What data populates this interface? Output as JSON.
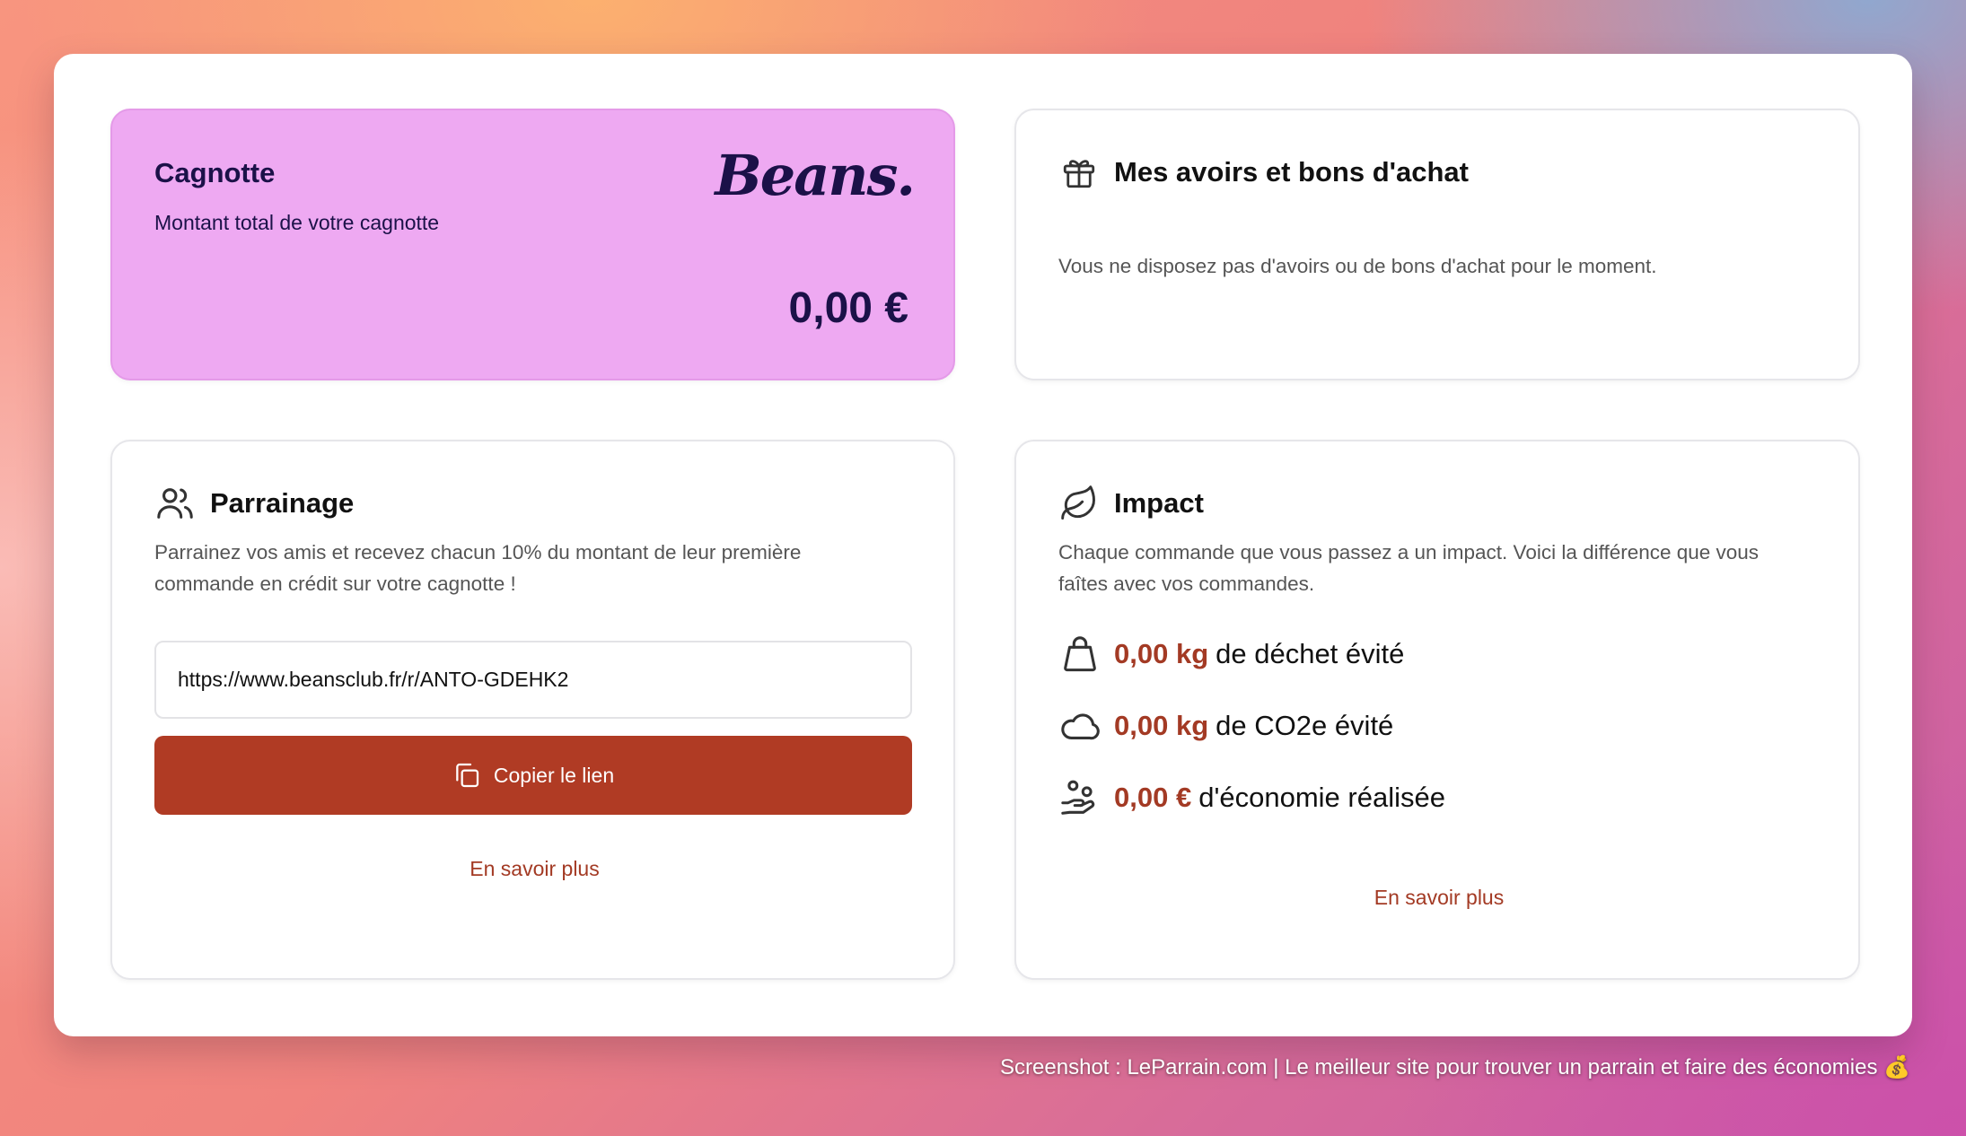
{
  "cagnotte": {
    "title": "Cagnotte",
    "subtitle": "Montant total de votre cagnotte",
    "brand": "Beans.",
    "amount": "0,00 €"
  },
  "avoirs": {
    "title": "Mes avoirs et bons d'achat",
    "message": "Vous ne disposez pas d'avoirs ou de bons d'achat pour le moment.",
    "icon": "gift-icon"
  },
  "parrainage": {
    "title": "Parrainage",
    "description_line1": "Parrainez vos amis et recevez chacun 10% du montant de leur première",
    "description_line2": "commande en crédit sur votre cagnotte !",
    "referral_link": "https://www.beansclub.fr/r/ANTO-GDEHK2",
    "copy_button": "Copier le lien",
    "learn_more": "En savoir plus",
    "icon": "users-icon"
  },
  "impact": {
    "title": "Impact",
    "description_line1": "Chaque commande que vous passez a un impact. Voici la différence que vous",
    "description_line2": "faîtes avec vos commandes.",
    "metrics": [
      {
        "value": "0,00 kg",
        "label": "de déchet évité",
        "icon": "bag-icon"
      },
      {
        "value": "0,00 kg",
        "label": "de CO2e évité",
        "icon": "cloud-icon"
      },
      {
        "value": "0,00 €",
        "label": "d'économie réalisée",
        "icon": "hand-coins-icon"
      }
    ],
    "learn_more": "En savoir plus",
    "icon": "leaf-icon"
  },
  "watermark": "Screenshot : LeParrain.com | Le meilleur site pour trouver un parrain et faire des économies 💰",
  "colors": {
    "accent": "#b03b24",
    "accent_text": "#a33a24",
    "cagnotte_bg": "#eea9f2",
    "navy": "#1b1148"
  }
}
